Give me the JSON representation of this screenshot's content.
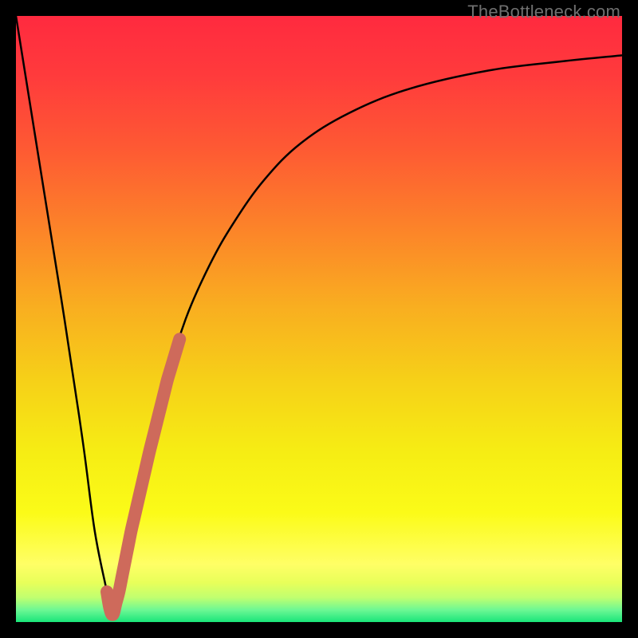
{
  "watermark": "TheBottleneck.com",
  "colors": {
    "frame": "#000000",
    "curve_stroke": "#000000",
    "marker_stroke": "#CE6A5B",
    "gradient_stops": [
      {
        "offset": 0.0,
        "color": "#FF2A3F"
      },
      {
        "offset": 0.1,
        "color": "#FF3B3C"
      },
      {
        "offset": 0.22,
        "color": "#FE5A33"
      },
      {
        "offset": 0.35,
        "color": "#FC8329"
      },
      {
        "offset": 0.48,
        "color": "#F9AE20"
      },
      {
        "offset": 0.6,
        "color": "#F6D018"
      },
      {
        "offset": 0.72,
        "color": "#F6ED14"
      },
      {
        "offset": 0.82,
        "color": "#FBFB18"
      },
      {
        "offset": 0.905,
        "color": "#FFFF66"
      },
      {
        "offset": 0.935,
        "color": "#E8FF5A"
      },
      {
        "offset": 0.96,
        "color": "#BFFF70"
      },
      {
        "offset": 0.98,
        "color": "#6DF894"
      },
      {
        "offset": 1.0,
        "color": "#19E57A"
      }
    ]
  },
  "chart_data": {
    "type": "line",
    "title": "",
    "xlabel": "",
    "ylabel": "",
    "xlim": [
      0,
      100
    ],
    "ylim": [
      0,
      100
    ],
    "series": [
      {
        "name": "bottleneck-curve",
        "x": [
          0,
          4,
          8,
          11,
          13,
          15,
          15.8,
          17,
          19,
          22,
          25,
          28,
          32,
          36,
          41,
          47,
          55,
          65,
          78,
          90,
          100
        ],
        "values": [
          100,
          75,
          50,
          30,
          15,
          5,
          0.5,
          5,
          15,
          28,
          40,
          50,
          59,
          66,
          73,
          79,
          84,
          88,
          91,
          92.5,
          93.5
        ]
      }
    ],
    "annotations": [
      {
        "name": "highlight-segment",
        "on_series": "bottleneck-curve",
        "x_range": [
          15,
          27
        ],
        "style": "thick-marker"
      }
    ]
  }
}
